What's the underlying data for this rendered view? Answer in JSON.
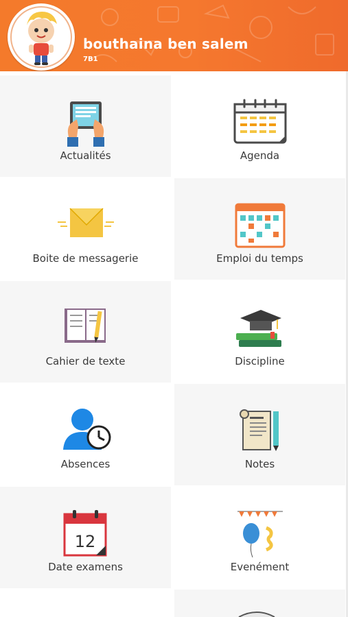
{
  "profile": {
    "name": "bouthaina ben salem",
    "class": "7B1"
  },
  "menu": {
    "items": [
      {
        "label": "Actualités",
        "icon": "news-tablet-icon"
      },
      {
        "label": "Agenda",
        "icon": "calendar-agenda-icon"
      },
      {
        "label": "Boite de messagerie",
        "icon": "envelope-icon"
      },
      {
        "label": "Emploi du temps",
        "icon": "timetable-icon"
      },
      {
        "label": "Cahier de texte",
        "icon": "notebook-icon"
      },
      {
        "label": "Discipline",
        "icon": "graduation-cap-icon"
      },
      {
        "label": "Absences",
        "icon": "user-clock-icon"
      },
      {
        "label": "Notes",
        "icon": "notes-scroll-icon"
      },
      {
        "label": "Date examens",
        "icon": "exam-calendar-icon"
      },
      {
        "label": "Evenément",
        "icon": "party-balloon-icon"
      }
    ],
    "exam_calendar_day": "12"
  },
  "colors": {
    "header_orange": "#f47a2b",
    "tile_light": "#f6f6f6",
    "label_text": "#3a3a3a"
  }
}
